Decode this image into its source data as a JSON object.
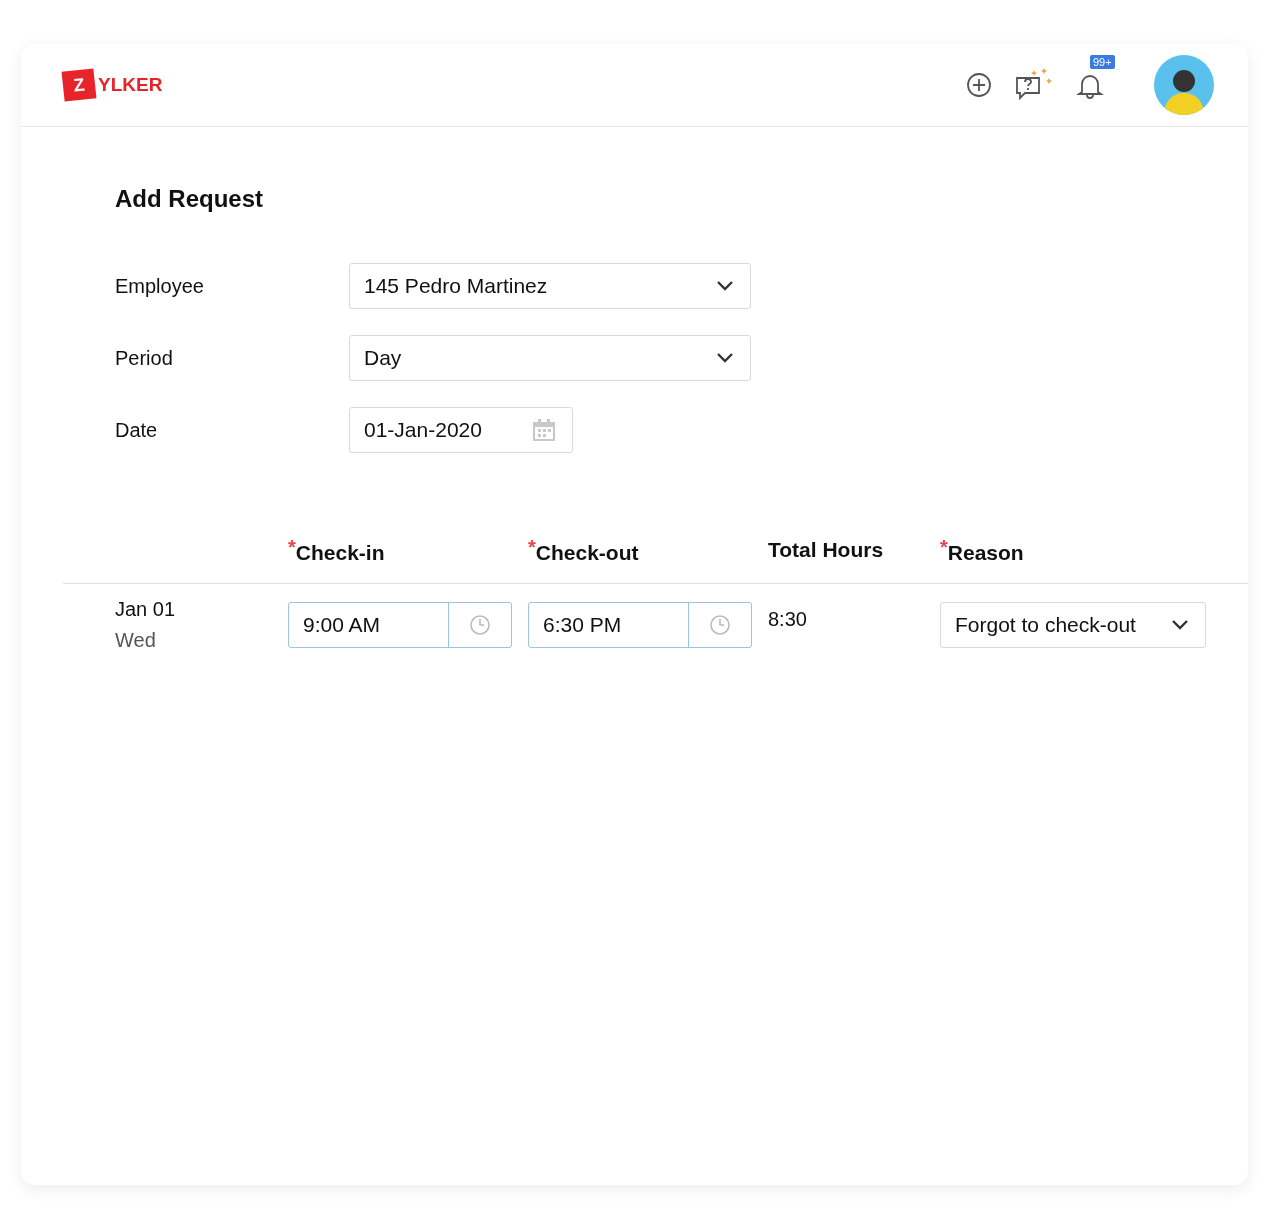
{
  "logo": {
    "letter": "Z",
    "text": "YLKER"
  },
  "header": {
    "notification_count": "99+"
  },
  "title": "Add Request",
  "fields": [
    {
      "label": "Employee",
      "kind": "select",
      "value": "145 Pedro Martinez"
    },
    {
      "label": "Period",
      "kind": "select",
      "value": "Day"
    },
    {
      "label": "Date",
      "kind": "date",
      "value": "01-Jan-2020"
    }
  ],
  "table": {
    "required_mark": "*",
    "columns": [
      {
        "label": "Check-in",
        "required": true
      },
      {
        "label": "Check-out",
        "required": true
      },
      {
        "label": "Total Hours",
        "required": false
      },
      {
        "label": "Reason",
        "required": true
      }
    ],
    "rows": [
      {
        "date": "Jan 01",
        "day": "Wed",
        "check_in": "9:00 AM",
        "check_out": "6:30 PM",
        "total": "8:30",
        "reason": "Forgot to check-out"
      }
    ]
  }
}
